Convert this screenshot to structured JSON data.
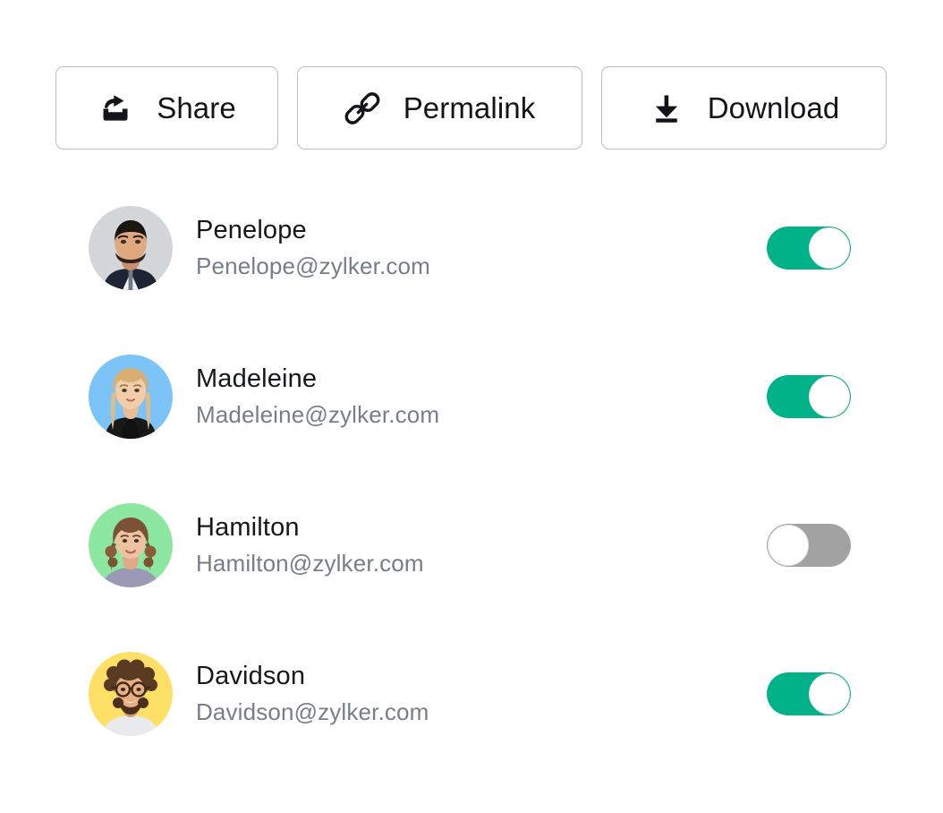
{
  "toolbar": {
    "buttons": [
      {
        "label": "Share",
        "icon": "share-box-icon",
        "name": "share-button"
      },
      {
        "label": "Permalink",
        "icon": "link-chain-icon",
        "name": "permalink-button"
      },
      {
        "label": "Download",
        "icon": "download-arrow-icon",
        "name": "download-button"
      }
    ]
  },
  "colors": {
    "toggle_on": "#00b288",
    "toggle_off": "#a2a2a2",
    "button_border": "#b9bfc6",
    "name_text": "#16181b",
    "email_text": "#767f88",
    "page_background": "#ffffff"
  },
  "users": [
    {
      "name": "Penelope",
      "email": "Penelope@zylker.com",
      "toggle_state": "on",
      "avatar_background": "#d4d7da",
      "avatar_alt": "portrait-man-dark-hair-beard"
    },
    {
      "name": "Madeleine",
      "email": "Madeleine@zylker.com",
      "toggle_state": "on",
      "avatar_background": "#7cc4f7",
      "avatar_alt": "portrait-woman-blonde-long-hair"
    },
    {
      "name": "Hamilton",
      "email": "Hamilton@zylker.com",
      "toggle_state": "off",
      "avatar_background": "#8ce8a0",
      "avatar_alt": "portrait-woman-curly-brown-hair"
    },
    {
      "name": "Davidson",
      "email": "Davidson@zylker.com",
      "toggle_state": "on",
      "avatar_background": "#ffe066",
      "avatar_alt": "portrait-man-curly-hair-glasses-beard"
    }
  ]
}
